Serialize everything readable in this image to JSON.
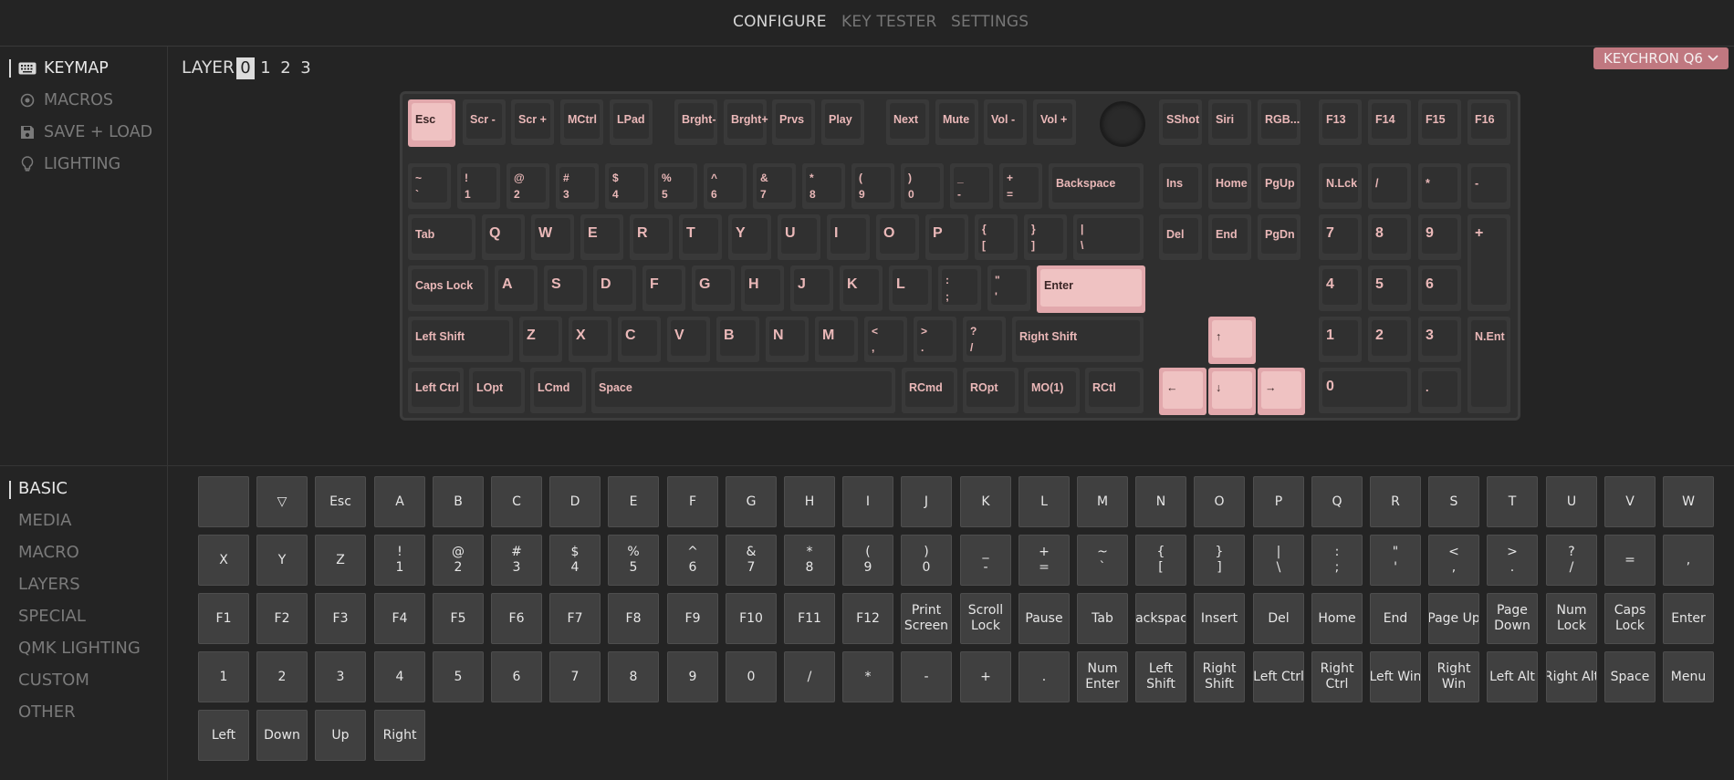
{
  "nav": {
    "items": [
      "CONFIGURE",
      "KEY TESTER",
      "SETTINGS"
    ],
    "active": 0
  },
  "sidebar": {
    "items": [
      {
        "label": "KEYMAP",
        "icon": "keyboard-icon"
      },
      {
        "label": "MACROS",
        "icon": "macro-dot-icon"
      },
      {
        "label": "SAVE + LOAD",
        "icon": "save-icon"
      },
      {
        "label": "LIGHTING",
        "icon": "lightbulb-icon"
      }
    ],
    "active": 0
  },
  "layers": {
    "label": "LAYER",
    "items": [
      "0",
      "1",
      "2",
      "3"
    ],
    "active": 0
  },
  "device": {
    "name": "KEYCHRON Q6",
    "icon": "chevron-down-icon"
  },
  "keyboard": {
    "keys": [
      {
        "label": "Esc",
        "highlight": true
      },
      {
        "label": "Scr -"
      },
      {
        "label": "Scr +"
      },
      {
        "label": "MCtrl"
      },
      {
        "label": "LPad"
      },
      {
        "label": "Brght-"
      },
      {
        "label": "Brght+"
      },
      {
        "label": "Prvs"
      },
      {
        "label": "Play"
      },
      {
        "label": "Next"
      },
      {
        "label": "Mute"
      },
      {
        "label": "Vol -"
      },
      {
        "label": "Vol +"
      },
      {
        "label": "",
        "encoder": true
      },
      {
        "label": "SShot"
      },
      {
        "label": "Siri"
      },
      {
        "label": "RGB..."
      },
      {
        "label": "F13"
      },
      {
        "label": "F14"
      },
      {
        "label": "F15"
      },
      {
        "label": "F16"
      },
      {
        "label": "~\n`"
      },
      {
        "label": "!\n1"
      },
      {
        "label": "@\n2"
      },
      {
        "label": "#\n3"
      },
      {
        "label": "$\n4"
      },
      {
        "label": "%\n5"
      },
      {
        "label": "^\n6"
      },
      {
        "label": "&\n7"
      },
      {
        "label": "*\n8"
      },
      {
        "label": "(\n9"
      },
      {
        "label": ")\n0"
      },
      {
        "label": "_\n-"
      },
      {
        "label": "+\n="
      },
      {
        "label": "Backspace"
      },
      {
        "label": "Ins"
      },
      {
        "label": "Home"
      },
      {
        "label": "PgUp"
      },
      {
        "label": "N.Lck"
      },
      {
        "label": "/"
      },
      {
        "label": "*"
      },
      {
        "label": "-"
      },
      {
        "label": "Tab"
      },
      {
        "label": "Q",
        "big": true
      },
      {
        "label": "W",
        "big": true
      },
      {
        "label": "E",
        "big": true
      },
      {
        "label": "R",
        "big": true
      },
      {
        "label": "T",
        "big": true
      },
      {
        "label": "Y",
        "big": true
      },
      {
        "label": "U",
        "big": true
      },
      {
        "label": "I",
        "big": true
      },
      {
        "label": "O",
        "big": true
      },
      {
        "label": "P",
        "big": true
      },
      {
        "label": "{\n["
      },
      {
        "label": "}\n]"
      },
      {
        "label": "|\n\\"
      },
      {
        "label": "Del"
      },
      {
        "label": "End"
      },
      {
        "label": "PgDn"
      },
      {
        "label": "7",
        "big": true
      },
      {
        "label": "8",
        "big": true
      },
      {
        "label": "9",
        "big": true
      },
      {
        "label": "+",
        "big": true
      },
      {
        "label": "Caps Lock"
      },
      {
        "label": "A",
        "big": true
      },
      {
        "label": "S",
        "big": true
      },
      {
        "label": "D",
        "big": true
      },
      {
        "label": "F",
        "big": true
      },
      {
        "label": "G",
        "big": true
      },
      {
        "label": "H",
        "big": true
      },
      {
        "label": "J",
        "big": true
      },
      {
        "label": "K",
        "big": true
      },
      {
        "label": "L",
        "big": true
      },
      {
        "label": ":\n;"
      },
      {
        "label": "\"\n'"
      },
      {
        "label": "Enter",
        "highlight": true
      },
      {
        "label": "4",
        "big": true
      },
      {
        "label": "5",
        "big": true
      },
      {
        "label": "6",
        "big": true
      },
      {
        "label": "Left Shift"
      },
      {
        "label": "Z",
        "big": true
      },
      {
        "label": "X",
        "big": true
      },
      {
        "label": "C",
        "big": true
      },
      {
        "label": "V",
        "big": true
      },
      {
        "label": "B",
        "big": true
      },
      {
        "label": "N",
        "big": true
      },
      {
        "label": "M",
        "big": true
      },
      {
        "label": "<\n,"
      },
      {
        "label": ">\n."
      },
      {
        "label": "?\n/"
      },
      {
        "label": "Right Shift"
      },
      {
        "label": "↑",
        "highlight": true
      },
      {
        "label": "1",
        "big": true
      },
      {
        "label": "2",
        "big": true
      },
      {
        "label": "3",
        "big": true
      },
      {
        "label": "N.Ent"
      },
      {
        "label": "Left Ctrl"
      },
      {
        "label": "LOpt"
      },
      {
        "label": "LCmd"
      },
      {
        "label": "Space"
      },
      {
        "label": "RCmd"
      },
      {
        "label": "ROpt"
      },
      {
        "label": "MO(1)"
      },
      {
        "label": "RCtl"
      },
      {
        "label": "←",
        "highlight": true
      },
      {
        "label": "↓",
        "highlight": true
      },
      {
        "label": "→",
        "highlight": true
      },
      {
        "label": "0",
        "big": true
      },
      {
        "label": "."
      }
    ]
  },
  "categories": {
    "items": [
      "BASIC",
      "MEDIA",
      "MACRO",
      "LAYERS",
      "SPECIAL",
      "QMK LIGHTING",
      "CUSTOM",
      "OTHER"
    ],
    "active": 0
  },
  "keycodes": {
    "rows": [
      [
        "",
        "▽",
        "Esc",
        "A",
        "B",
        "C",
        "D",
        "E",
        "F",
        "G",
        "H",
        "I",
        "J",
        "K",
        "L",
        "M",
        "N",
        "O",
        "P",
        "Q",
        "R",
        "S",
        "T",
        "U",
        "V",
        "W"
      ],
      [
        "X",
        "Y",
        "Z",
        "!\n1",
        "@\n2",
        "#\n3",
        "$\n4",
        "%\n5",
        "^\n6",
        "&\n7",
        "*\n8",
        "(\n9",
        ")\n0",
        "_\n-",
        "+\n=",
        "~\n`",
        "{\n[",
        "}\n]",
        "|\n\\",
        ":\n;",
        "\"\n'",
        "<\n,",
        ">\n.",
        "?\n/",
        "=",
        ","
      ],
      [
        "F1",
        "F2",
        "F3",
        "F4",
        "F5",
        "F6",
        "F7",
        "F8",
        "F9",
        "F10",
        "F11",
        "F12",
        "Print\nScreen",
        "Scroll\nLock",
        "Pause",
        "Tab",
        "Backspace",
        "Insert",
        "Del",
        "Home",
        "End",
        "Page Up",
        "Page\nDown",
        "Num\nLock",
        "Caps\nLock",
        "Enter"
      ],
      [
        "1",
        "2",
        "3",
        "4",
        "5",
        "6",
        "7",
        "8",
        "9",
        "0",
        "/",
        "*",
        "-",
        "+",
        ".",
        "Num\nEnter",
        "Left\nShift",
        "Right\nShift",
        "Left Ctrl",
        "Right\nCtrl",
        "Left Win",
        "Right\nWin",
        "Left Alt",
        "Right Alt",
        "Space",
        "Menu"
      ],
      [
        "Left",
        "Down",
        "Up",
        "Right"
      ]
    ]
  },
  "colors": {
    "accent": "#c07880",
    "key_highlight": "#efc2c2",
    "legend": "#eab8b8"
  }
}
